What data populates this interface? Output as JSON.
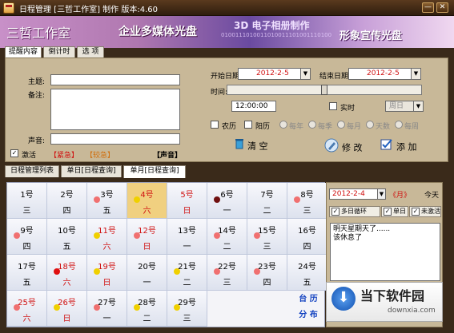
{
  "window": {
    "title": "日程管理 [三哲工作室] 制作  版本:4.60",
    "min_label": "—",
    "close_label": "✕"
  },
  "banner": {
    "logo": "三哲工作室",
    "slogan1": "企业多媒体光盘",
    "slogan2": "3D 电子相册制作",
    "slogan3": "形象宣传光盘",
    "binary": "0100111010011010011101001110100"
  },
  "top_tabs": [
    {
      "label": "提醒内容"
    },
    {
      "label": "倒计时"
    },
    {
      "label": "选 项"
    }
  ],
  "form": {
    "subject_label": "主题:",
    "subject_value": "",
    "notes_label": "备注:",
    "notes_value": "",
    "sound_label": "声音:",
    "sound_value": "",
    "activate_label": "激活",
    "urgent_tag": "【紧急】",
    "priority_tag": "【较急】",
    "sound_tag": "【声音】",
    "start_date_label": "开始日期:",
    "start_date_value": "2012-2-5",
    "end_date_label": "结束日期:",
    "end_date_value": "2012-2-5",
    "time_label": "时间:",
    "time_value": "12:00:00",
    "realtime_label": "实时",
    "weekday_value": "周日",
    "lunar_label": "农历",
    "solar_label": "阳历",
    "repeat_options": [
      "每年",
      "每季",
      "每月",
      "天数",
      "每周"
    ]
  },
  "actions": {
    "clear_label": "清 空",
    "modify_label": "修 改",
    "add_label": "添 加"
  },
  "bottom_tabs": [
    {
      "label": "日程管理列表"
    },
    {
      "label": "单日[日程查询]"
    },
    {
      "label": "单月[日程查询]"
    }
  ],
  "calendar": {
    "days": [
      {
        "day": "1号",
        "wd": "三",
        "color": "",
        "dot": ""
      },
      {
        "day": "2号",
        "wd": "四",
        "color": "",
        "dot": ""
      },
      {
        "day": "3号",
        "wd": "五",
        "color": "",
        "dot": "#f07070"
      },
      {
        "day": "4号",
        "wd": "六",
        "color": "red",
        "dot": "#f0d000",
        "today": true
      },
      {
        "day": "5号",
        "wd": "日",
        "color": "red",
        "dot": ""
      },
      {
        "day": "6号",
        "wd": "一",
        "color": "",
        "dot": "#701010"
      },
      {
        "day": "7号",
        "wd": "二",
        "color": "",
        "dot": ""
      },
      {
        "day": "8号",
        "wd": "三",
        "color": "",
        "dot": "#f07070"
      },
      {
        "day": "9号",
        "wd": "四",
        "color": "",
        "dot": "#f07070"
      },
      {
        "day": "10号",
        "wd": "五",
        "color": "",
        "dot": ""
      },
      {
        "day": "11号",
        "wd": "六",
        "color": "red",
        "dot": "#f0d000"
      },
      {
        "day": "12号",
        "wd": "日",
        "color": "red",
        "dot": "#f07070"
      },
      {
        "day": "13号",
        "wd": "一",
        "color": "",
        "dot": ""
      },
      {
        "day": "14号",
        "wd": "二",
        "color": "",
        "dot": "#f07070"
      },
      {
        "day": "15号",
        "wd": "三",
        "color": "",
        "dot": "#f07070"
      },
      {
        "day": "16号",
        "wd": "四",
        "color": "",
        "dot": ""
      },
      {
        "day": "17号",
        "wd": "五",
        "color": "",
        "dot": ""
      },
      {
        "day": "18号",
        "wd": "六",
        "color": "red",
        "dot": "#e01010"
      },
      {
        "day": "19号",
        "wd": "日",
        "color": "red",
        "dot": "#f0d000"
      },
      {
        "day": "20号",
        "wd": "一",
        "color": "",
        "dot": ""
      },
      {
        "day": "21号",
        "wd": "二",
        "color": "",
        "dot": "#f0d000"
      },
      {
        "day": "22号",
        "wd": "三",
        "color": "",
        "dot": "#f07070"
      },
      {
        "day": "23号",
        "wd": "四",
        "color": "",
        "dot": "#f07070"
      },
      {
        "day": "24号",
        "wd": "五",
        "color": "",
        "dot": ""
      },
      {
        "day": "25号",
        "wd": "六",
        "color": "red",
        "dot": "#f07070"
      },
      {
        "day": "26号",
        "wd": "日",
        "color": "red",
        "dot": "#f0d000"
      },
      {
        "day": "27号",
        "wd": "一",
        "color": "",
        "dot": "#f07070"
      },
      {
        "day": "28号",
        "wd": "二",
        "color": "",
        "dot": "#f0d000"
      },
      {
        "day": "29号",
        "wd": "三",
        "color": "",
        "dot": "#f0d000"
      }
    ],
    "footer_line1": "台 历",
    "footer_line2": "分 布"
  },
  "side": {
    "date_value": "2012-2-4",
    "prev_label": "《月》",
    "next_label": "》",
    "today_label": "今天",
    "options": [
      {
        "label": "多日循环",
        "checked": true
      },
      {
        "label": "单日",
        "checked": true
      },
      {
        "label": "未激活",
        "checked": true
      }
    ],
    "notes": [
      "明天星期天了......",
      "该休息了"
    ]
  },
  "watermark": {
    "title": "当下软件园",
    "url": "downxia.com"
  },
  "colors": {
    "accent_red": "#d01010",
    "panel_bg": "#c8b898",
    "today_bg": "#f0d080"
  }
}
